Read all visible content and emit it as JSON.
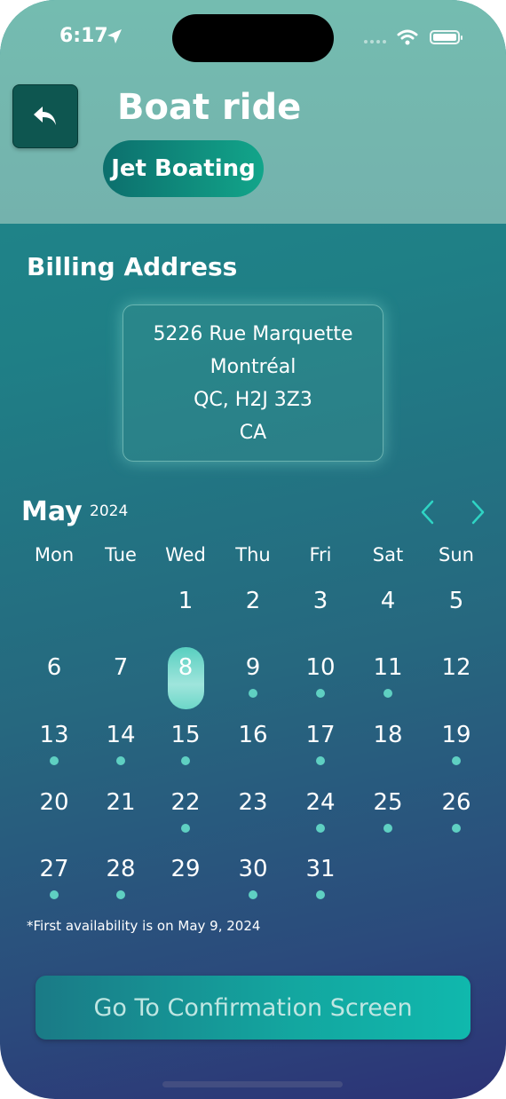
{
  "status_bar": {
    "time": "6:17"
  },
  "header": {
    "title": "Boat ride",
    "category_chip": "Jet Boating"
  },
  "billing": {
    "label": "Billing Address",
    "lines": [
      "5226 Rue Marquette",
      "Montréal",
      "QC, H2J 3Z3",
      "CA"
    ]
  },
  "calendar": {
    "month": "May",
    "year": "2024",
    "weekdays": [
      "Mon",
      "Tue",
      "Wed",
      "Thu",
      "Fri",
      "Sat",
      "Sun"
    ],
    "first_weekday_index": 2,
    "days_in_month": 31,
    "selected_day": 8,
    "available_days": [
      9,
      10,
      11,
      13,
      14,
      15,
      17,
      19,
      22,
      24,
      25,
      26,
      27,
      28,
      30,
      31
    ]
  },
  "note": "*First availability is on May 9, 2024",
  "confirm_button": "Go To Confirmation Screen",
  "colors": {
    "available_dot": "#5fd0c2",
    "selected_pill": "#9fe5dc",
    "nav_arrow": "#2fd4c4"
  },
  "icons": {
    "back": "reply-arrow-icon",
    "prev": "chevron-left-icon",
    "next": "chevron-right-icon",
    "location": "location-arrow-icon",
    "wifi": "wifi-icon",
    "battery": "battery-icon"
  }
}
